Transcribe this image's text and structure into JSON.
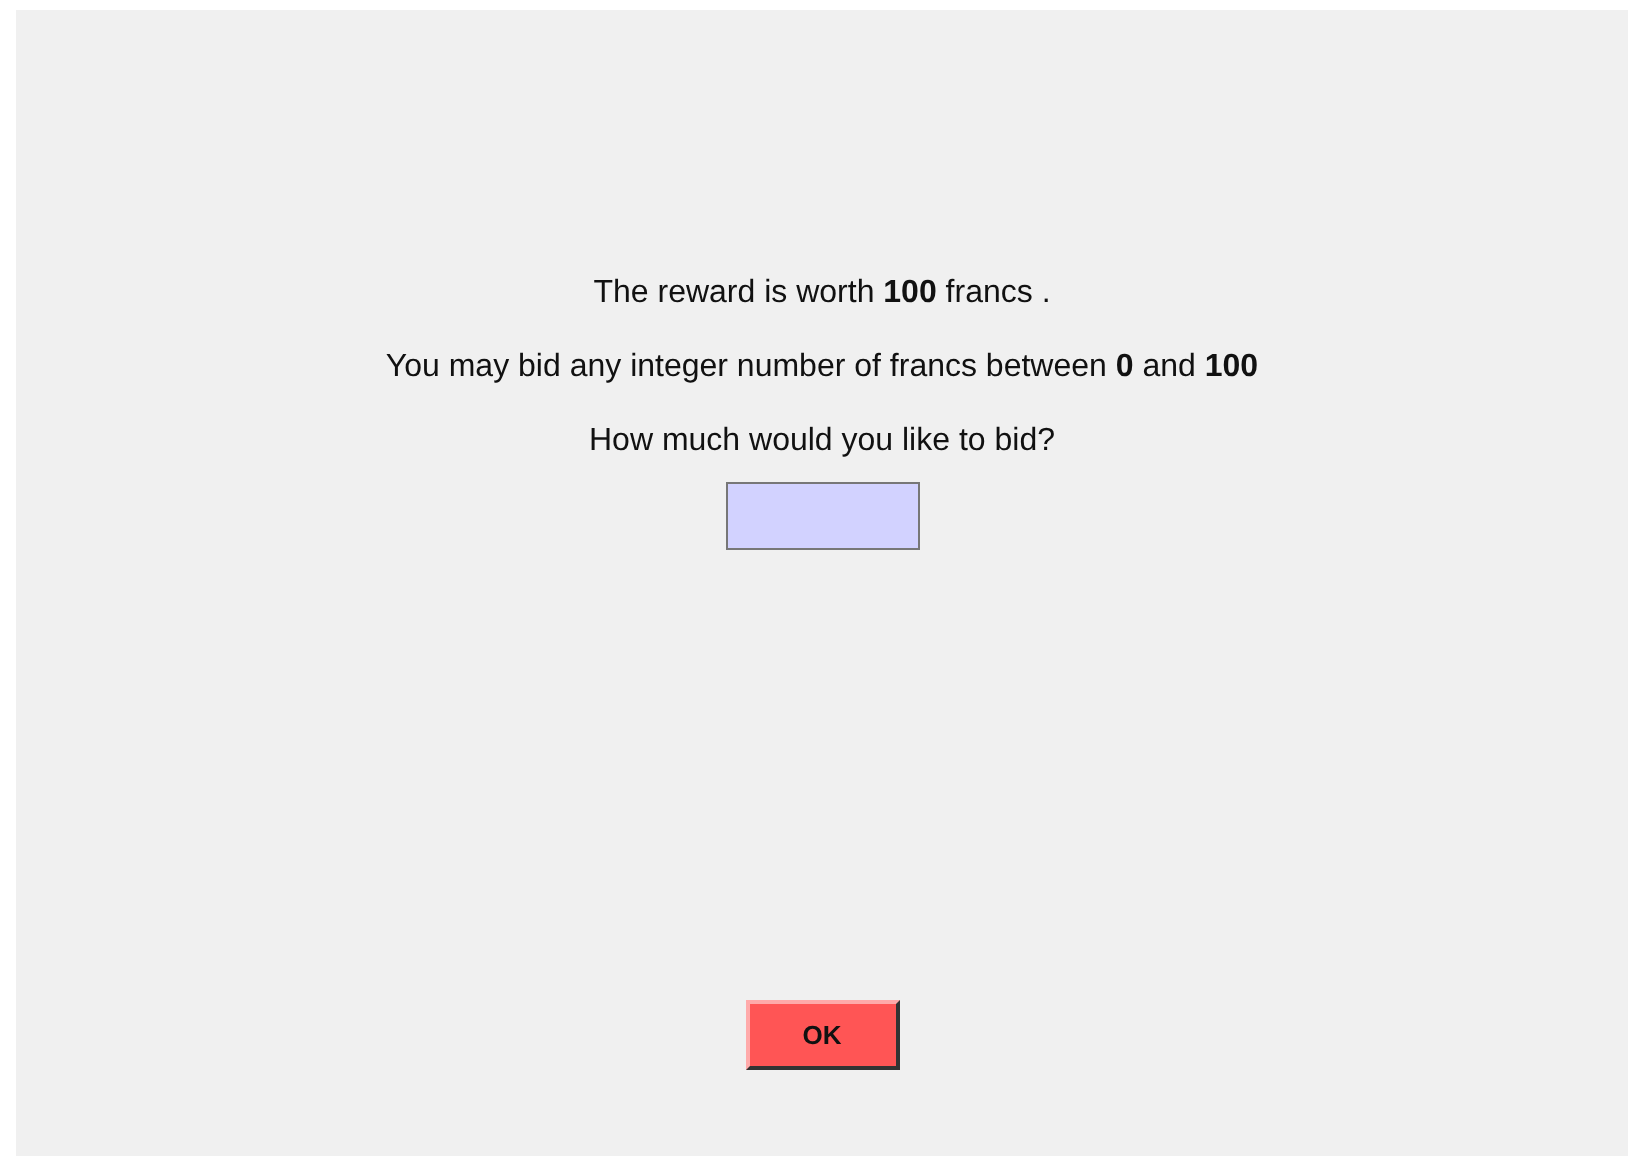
{
  "lines": [
    "The reward is worth **100** francs .",
    "You may bid any integer number of francs between **0** and **100**",
    "How much would you like to bid?"
  ],
  "ok_button": {
    "label": "OK"
  }
}
